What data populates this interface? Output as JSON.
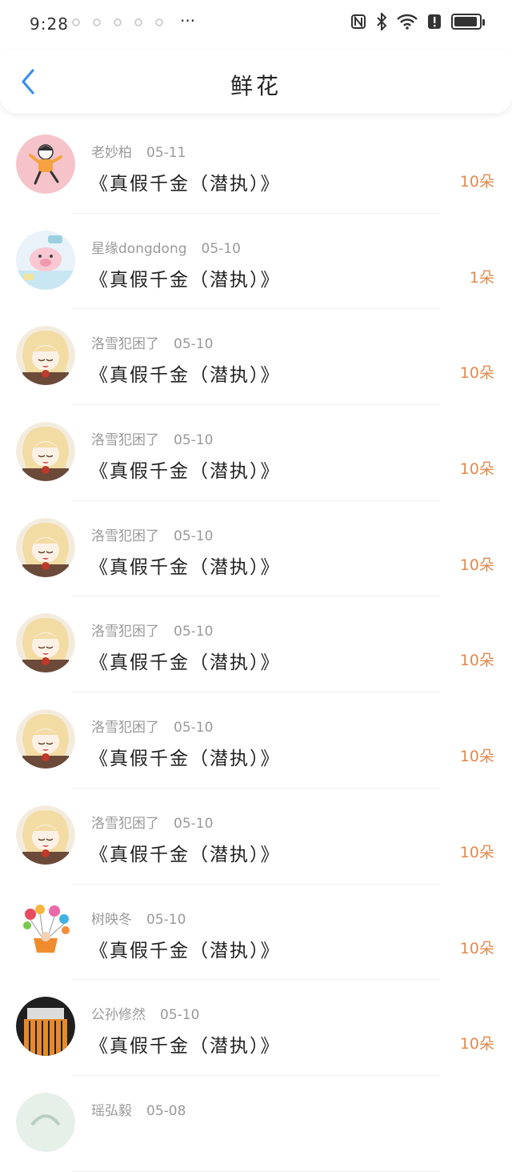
{
  "status_bar": {
    "time": "9:28",
    "more": "···",
    "icons": [
      "nfc-icon",
      "bluetooth-icon",
      "wifi-icon",
      "alert-icon",
      "battery-icon"
    ]
  },
  "header": {
    "title": "鲜花",
    "back_icon": "chevron-left-icon"
  },
  "colors": {
    "accent": "#3b8ee8",
    "count": "#e08a4e",
    "secondary_text": "#9a9a9a"
  },
  "items": [
    {
      "name": "老妙柏",
      "date": "05-11",
      "book": "《真假千金（潜执）》",
      "count": "10朵",
      "avatar": "girl-cartoon"
    },
    {
      "name": "星缘dongdong",
      "date": "05-10",
      "book": "《真假千金（潜执）》",
      "count": "1朵",
      "avatar": "pink-pig"
    },
    {
      "name": "洛雪犯困了",
      "date": "05-10",
      "book": "《真假千金（潜执）》",
      "count": "10朵",
      "avatar": "anime-blonde"
    },
    {
      "name": "洛雪犯困了",
      "date": "05-10",
      "book": "《真假千金（潜执）》",
      "count": "10朵",
      "avatar": "anime-blonde"
    },
    {
      "name": "洛雪犯困了",
      "date": "05-10",
      "book": "《真假千金（潜执）》",
      "count": "10朵",
      "avatar": "anime-blonde"
    },
    {
      "name": "洛雪犯困了",
      "date": "05-10",
      "book": "《真假千金（潜执）》",
      "count": "10朵",
      "avatar": "anime-blonde"
    },
    {
      "name": "洛雪犯困了",
      "date": "05-10",
      "book": "《真假千金（潜执）》",
      "count": "10朵",
      "avatar": "anime-blonde"
    },
    {
      "name": "洛雪犯困了",
      "date": "05-10",
      "book": "《真假千金（潜执）》",
      "count": "10朵",
      "avatar": "anime-blonde"
    },
    {
      "name": "树映冬",
      "date": "05-10",
      "book": "《真假千金（潜执）》",
      "count": "10朵",
      "avatar": "balloons"
    },
    {
      "name": "公孙修然",
      "date": "05-10",
      "book": "《真假千金（潜执）》",
      "count": "10朵",
      "avatar": "dark-stripes"
    },
    {
      "name": "瑶弘毅",
      "date": "05-08",
      "book": "",
      "count": "",
      "avatar": "light-green"
    }
  ]
}
